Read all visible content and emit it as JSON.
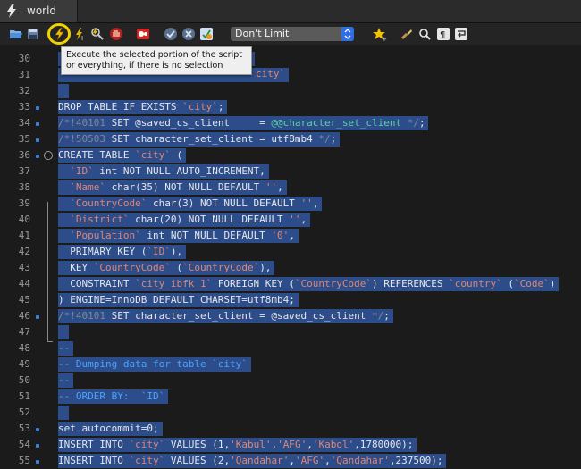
{
  "tab": {
    "label": "world"
  },
  "toolbar": {
    "limit_select": "Don't Limit",
    "tooltip": "Execute the selected portion of the script or everything, if there is no selection"
  },
  "editor": {
    "lines": [
      {
        "num": "30",
        "code": "",
        "marker": false,
        "sel_width": 0
      },
      {
        "num": "31",
        "code": "",
        "marker": false,
        "sel_width": 0
      },
      {
        "num": "32",
        "code": "",
        "marker": false,
        "sel_width": 0
      },
      {
        "num": "33",
        "code": "DROP TABLE IF EXISTS `city`;",
        "marker": true
      },
      {
        "num": "34",
        "code": "/*!40101 SET @saved_cs_client     = @@character_set_client */;",
        "marker": true
      },
      {
        "num": "35",
        "code": "/*!50503 SET character_set_client = utf8mb4 */;",
        "marker": true
      },
      {
        "num": "36",
        "code": "CREATE TABLE `city` (",
        "marker": true
      },
      {
        "num": "37",
        "code": "  `ID` int NOT NULL AUTO_INCREMENT,",
        "marker": false
      },
      {
        "num": "38",
        "code": "  `Name` char(35) NOT NULL DEFAULT '',",
        "marker": false
      },
      {
        "num": "39",
        "code": "  `CountryCode` char(3) NOT NULL DEFAULT '',",
        "marker": false
      },
      {
        "num": "40",
        "code": "  `District` char(20) NOT NULL DEFAULT '',",
        "marker": false
      },
      {
        "num": "41",
        "code": "  `Population` int NOT NULL DEFAULT '0',",
        "marker": false
      },
      {
        "num": "42",
        "code": "  PRIMARY KEY (`ID`),",
        "marker": false
      },
      {
        "num": "43",
        "code": "  KEY `CountryCode` (`CountryCode`),",
        "marker": false
      },
      {
        "num": "44",
        "code": "  CONSTRAINT `city_ibfk_1` FOREIGN KEY (`CountryCode`) REFERENCES `country` (`Code`)",
        "marker": false
      },
      {
        "num": "45",
        "code": ") ENGINE=InnoDB DEFAULT CHARSET=utf8mb4;",
        "marker": false
      },
      {
        "num": "46",
        "code": "/*!40101 SET character_set_client = @saved_cs_client */;",
        "marker": true
      },
      {
        "num": "47",
        "code": "",
        "marker": false
      },
      {
        "num": "48",
        "code": "--",
        "marker": false
      },
      {
        "num": "49",
        "code": "-- Dumping data for table `city`",
        "marker": false
      },
      {
        "num": "50",
        "code": "--",
        "marker": false
      },
      {
        "num": "51",
        "code": "-- ORDER BY:  `ID`",
        "marker": false
      },
      {
        "num": "52",
        "code": "",
        "marker": false
      },
      {
        "num": "53",
        "code": "set autocommit=0;",
        "marker": true
      },
      {
        "num": "54",
        "code": "INSERT INTO `city` VALUES (1,'Kabul','AFG','Kabol',1780000);",
        "marker": true
      },
      {
        "num": "55",
        "code": "INSERT INTO `city` VALUES (2,'Qandahar','AFG','Qandahar',237500);",
        "marker": true
      }
    ],
    "line31_tail": "city`"
  },
  "colors": {
    "selection": "#2d4d8a",
    "marker": "#3b7fd8",
    "highlight_ring": "#f2d300"
  },
  "icons": [
    "open-folder-icon",
    "save-icon",
    "execute-lightning-icon",
    "execute-current-icon",
    "explain-icon",
    "stop-icon",
    "toggle-continue-icon",
    "commit-icon",
    "rollback-icon",
    "autocommit-icon",
    "bookmark-star-icon",
    "beautify-brush-icon",
    "search-icon",
    "invisibles-icon",
    "wrap-icon"
  ]
}
